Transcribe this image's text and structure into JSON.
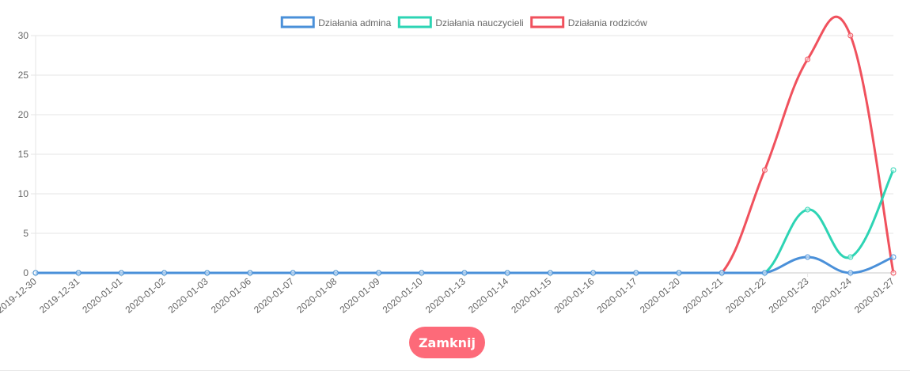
{
  "colors": {
    "admin": "#4a90d9",
    "teachers": "#2dd4b4",
    "parents": "#f0515d",
    "button_bg": "#fd6a79",
    "grid": "#e5e5e5",
    "axis": "#c8c8c8",
    "tick_text": "#666666"
  },
  "chart_data": {
    "type": "line",
    "categories": [
      "2019-12-30",
      "2019-12-31",
      "2020-01-01",
      "2020-01-02",
      "2020-01-03",
      "2020-01-06",
      "2020-01-07",
      "2020-01-08",
      "2020-01-09",
      "2020-01-10",
      "2020-01-13",
      "2020-01-14",
      "2020-01-15",
      "2020-01-16",
      "2020-01-17",
      "2020-01-20",
      "2020-01-21",
      "2020-01-22",
      "2020-01-23",
      "2020-01-24",
      "2020-01-27"
    ],
    "series": [
      {
        "name": "Działania admina",
        "color_key": "admin",
        "values": [
          0,
          0,
          0,
          0,
          0,
          0,
          0,
          0,
          0,
          0,
          0,
          0,
          0,
          0,
          0,
          0,
          0,
          0,
          2,
          0,
          2
        ]
      },
      {
        "name": "Działania nauczycieli",
        "color_key": "teachers",
        "values": [
          0,
          0,
          0,
          0,
          0,
          0,
          0,
          0,
          0,
          0,
          0,
          0,
          0,
          0,
          0,
          0,
          0,
          0,
          8,
          2,
          13
        ]
      },
      {
        "name": "Działania rodziców",
        "color_key": "parents",
        "values": [
          0,
          0,
          0,
          0,
          0,
          0,
          0,
          0,
          0,
          0,
          0,
          0,
          0,
          0,
          0,
          0,
          0,
          13,
          27,
          30,
          0
        ]
      }
    ],
    "y_ticks": [
      "0",
      "5",
      "10",
      "15",
      "20",
      "25",
      "30"
    ],
    "ylim": [
      0,
      30
    ],
    "grid": true,
    "legend_position": "top-center"
  },
  "button": {
    "label": "Zamknij"
  }
}
